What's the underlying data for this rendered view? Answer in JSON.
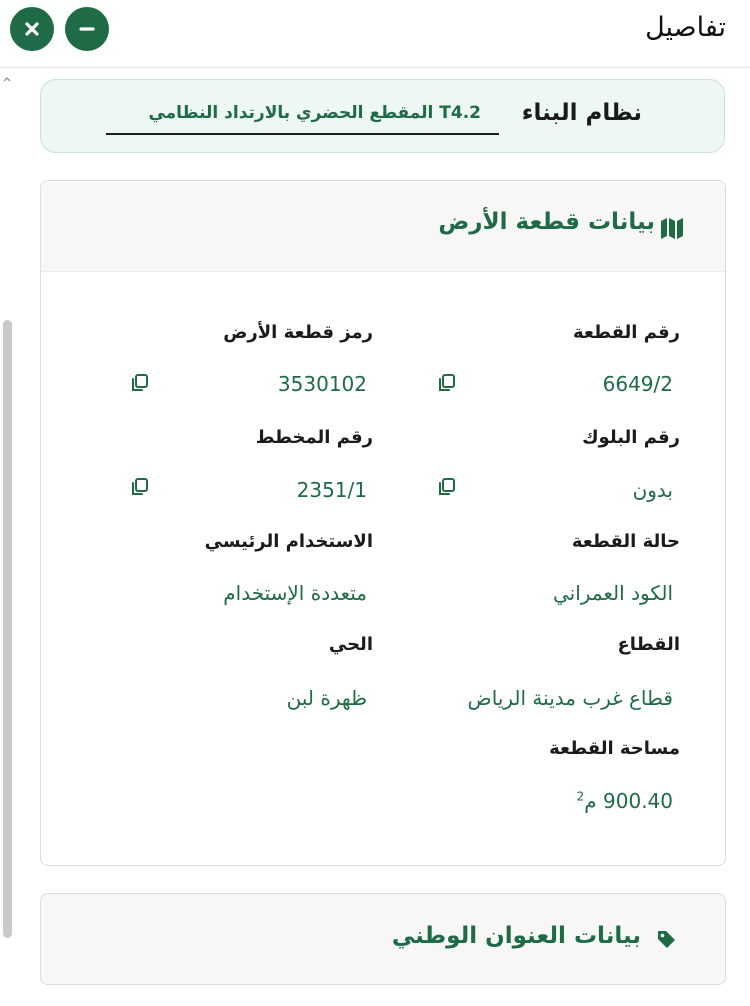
{
  "header": {
    "title": "تفاصيل"
  },
  "building_system": {
    "label": "نظام البناء",
    "value": "T4.2 المقطع الحضري بالارتداد النظامي"
  },
  "land_card": {
    "title": "بيانات قطعة الأرض",
    "icon": "map-icon",
    "fields": {
      "plot_number": {
        "label": "رقم القطعة",
        "value": "6649/2"
      },
      "plot_code": {
        "label": "رمز قطعة الأرض",
        "value": "3530102"
      },
      "block_number": {
        "label": "رقم البلوك",
        "value": "بدون"
      },
      "plan_number": {
        "label": "رقم المخطط",
        "value": "2351/1"
      },
      "plot_status": {
        "label": "حالة القطعة",
        "value": "الكود العمراني"
      },
      "main_use": {
        "label": "الاستخدام الرئيسي",
        "value": "متعددة الإستخدام"
      },
      "sector": {
        "label": "القطاع",
        "value": "قطاع غرب مدينة الرياض"
      },
      "district": {
        "label": "الحي",
        "value": "ظهرة لبن"
      },
      "area": {
        "label": "مساحة القطعة",
        "value": "900.40",
        "unit": "م",
        "unit_sup": "2"
      }
    }
  },
  "address_card": {
    "title": "بيانات العنوان الوطني",
    "icon": "tag-icon"
  },
  "colors": {
    "accent": "#1f6b45",
    "panel": "#edf8f4"
  }
}
